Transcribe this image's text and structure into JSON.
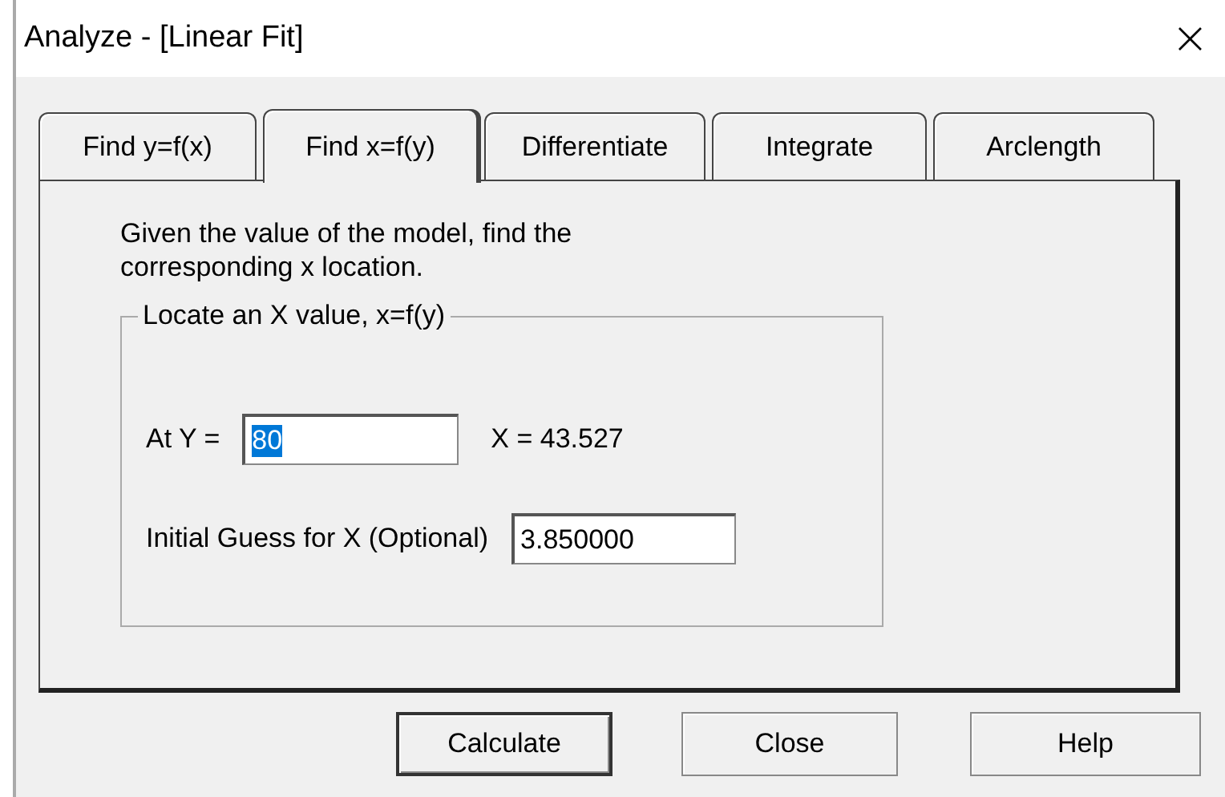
{
  "window": {
    "title": "Analyze - [Linear Fit]",
    "close": "×"
  },
  "tabs": [
    {
      "label": "Find y=f(x)",
      "selected": false
    },
    {
      "label": "Find x=f(y)",
      "selected": true
    },
    {
      "label": "Differentiate",
      "selected": false
    },
    {
      "label": "Integrate",
      "selected": false
    },
    {
      "label": "Arclength",
      "selected": false
    }
  ],
  "description": "Given the value of the model, find the corresponding x location.",
  "group": {
    "title": "Locate an X value, x=f(y)",
    "at_y": {
      "label": "At Y =",
      "value": "80",
      "text_selected": true
    },
    "result": "X = 43.527",
    "initial_guess": {
      "label": "Initial Guess for X (Optional)",
      "value": "3.850000"
    }
  },
  "buttons": [
    {
      "label": "Calculate",
      "default": true
    },
    {
      "label": "Close",
      "default": false
    },
    {
      "label": "Help",
      "default": false
    }
  ]
}
